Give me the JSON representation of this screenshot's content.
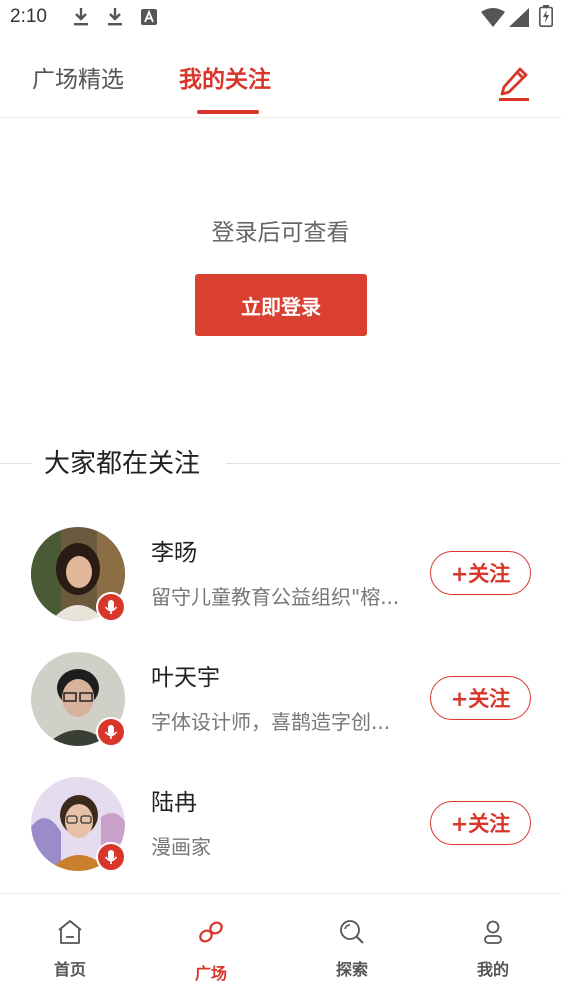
{
  "status_bar": {
    "time": "2:10",
    "left_icons": [
      "download-icon",
      "download-icon",
      "font-app-icon"
    ],
    "right_icons": [
      "wifi-icon",
      "signal-icon",
      "battery-charging-icon"
    ]
  },
  "top_tabs": {
    "items": [
      {
        "label": "广场精选",
        "active": false
      },
      {
        "label": "我的关注",
        "active": true
      }
    ],
    "edit_icon": "edit-pencil-icon"
  },
  "login": {
    "hint": "登录后可查看",
    "button_label": "立即登录"
  },
  "recommend": {
    "title": "大家都在关注",
    "users": [
      {
        "name": "李旸",
        "desc": "留守儿童教育公益组织\"榕...",
        "follow_label": "+关注"
      },
      {
        "name": "叶天宇",
        "desc": "字体设计师，喜鹊造字创...",
        "follow_label": "+关注"
      },
      {
        "name": "陆冉",
        "desc": "漫画家",
        "follow_label": "+关注"
      }
    ]
  },
  "bottom_nav": {
    "items": [
      {
        "label": "首页",
        "icon": "home-icon",
        "active": false
      },
      {
        "label": "广场",
        "icon": "link-icon",
        "active": true
      },
      {
        "label": "探索",
        "icon": "search-icon",
        "active": false
      },
      {
        "label": "我的",
        "icon": "profile-icon",
        "active": false
      }
    ]
  },
  "colors": {
    "accent": "#d9362b",
    "button": "#d9402f",
    "text_primary": "#222222",
    "text_secondary": "#777777"
  }
}
